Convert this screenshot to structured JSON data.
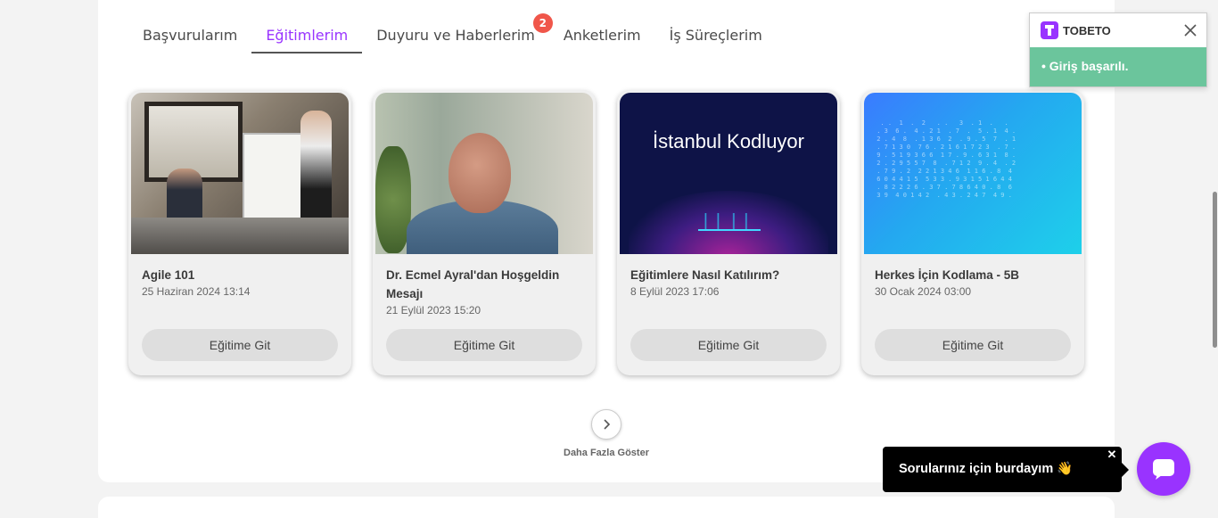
{
  "tabs": [
    {
      "label": "Başvurularım"
    },
    {
      "label": "Eğitimlerim",
      "active": true
    },
    {
      "label": "Duyuru ve Haberlerim",
      "badge": "2"
    },
    {
      "label": "Anketlerim"
    },
    {
      "label": "İş Süreçlerim"
    }
  ],
  "cards": [
    {
      "title": "Agile 101",
      "date": "25 Haziran 2024 13:14",
      "button": "Eğitime Git",
      "image": "meeting-photo"
    },
    {
      "title": "Dr. Ecmel Ayral'dan Hoşgeldin Mesajı",
      "date": "21 Eylül 2023 15:20",
      "button": "Eğitime Git",
      "image": "portrait-photo"
    },
    {
      "title": "Eğitimlere Nasıl Katılırım?",
      "date": "8 Eylül 2023 17:06",
      "button": "Eğitime Git",
      "image": "istanbul-kodluyor-banner",
      "image_text": "İstanbul Kodluyor"
    },
    {
      "title": "Herkes İçin Kodlama - 5B",
      "date": "30 Ocak 2024 03:00",
      "button": "Eğitime Git",
      "image": "digital-numbers-banner"
    }
  ],
  "more": {
    "label": "Daha Fazla Göster",
    "icon": "chevron-right-icon"
  },
  "toast": {
    "title": "TOBETO",
    "message": "• Giriş başarılı.",
    "color": "#6bc59c"
  },
  "chat": {
    "message": "Sorularınız için burdayım 👋",
    "icon": "chat-icon",
    "color": "#9933ff"
  },
  "colors": {
    "accent": "#9933ff",
    "badge": "#f0564a"
  }
}
